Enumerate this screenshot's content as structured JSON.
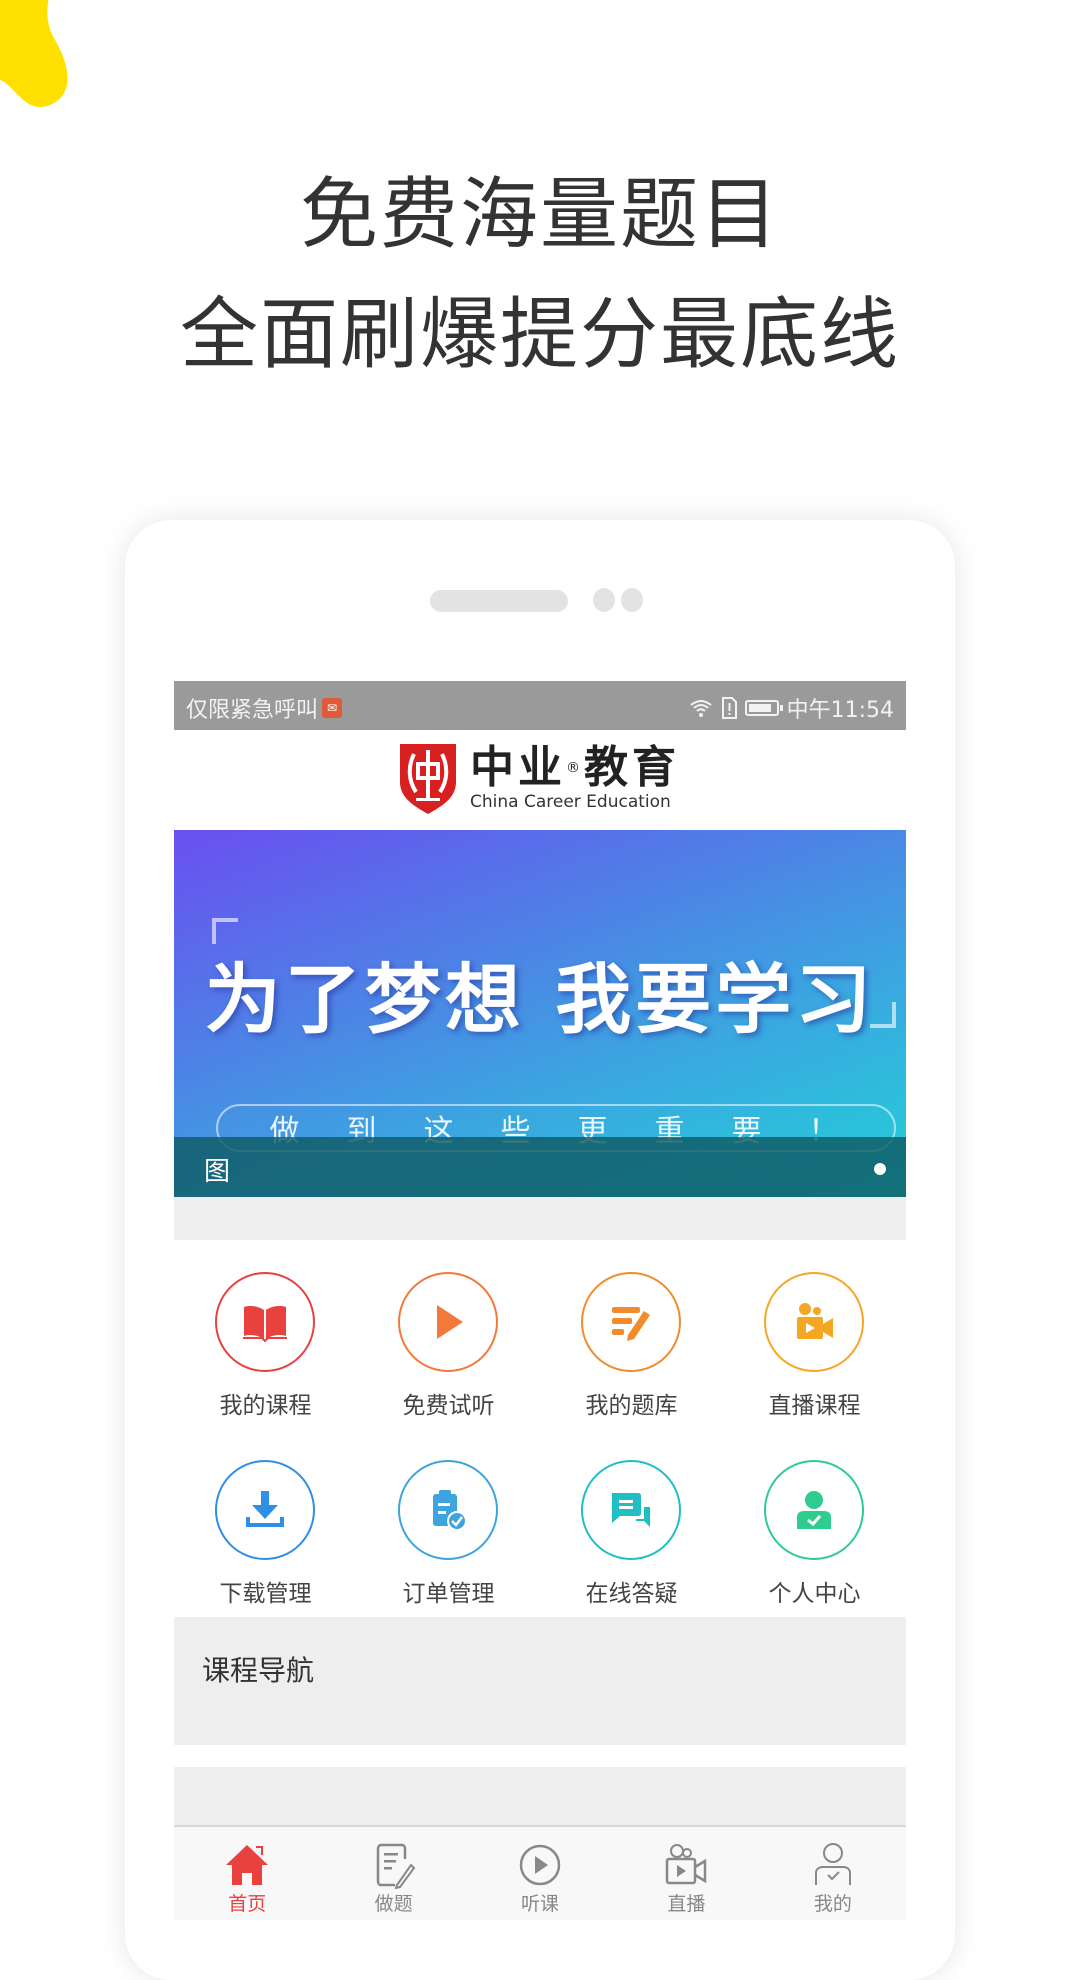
{
  "promo": {
    "headline_1": "免费海量题目",
    "headline_2": "全面刷爆提分最底线",
    "accent_yellow": "#ffe000"
  },
  "status_bar": {
    "left_text": "仅限紧急呼叫",
    "left_badge_icon": "app-notification-icon",
    "time": "中午11:54",
    "icons": [
      "wifi-icon",
      "sim-alert-icon",
      "battery-icon"
    ]
  },
  "header": {
    "brand_cn": "中业",
    "brand_registered": "®",
    "brand_cn_2": "教育",
    "brand_en": "China Career Education",
    "brand_color": "#d7201f"
  },
  "banner": {
    "title": "为了梦想 我要学习",
    "subtitle_chars": [
      "做",
      "到",
      "这",
      "些",
      "更",
      "重",
      "要",
      "！"
    ],
    "caption": "图",
    "page_index": 1,
    "page_count": 1
  },
  "grid": {
    "items": [
      {
        "label": "我的课程",
        "icon": "book-icon",
        "color": "#e8413e"
      },
      {
        "label": "免费试听",
        "icon": "play-icon",
        "color": "#f2793a"
      },
      {
        "label": "我的题库",
        "icon": "edit-list-icon",
        "color": "#f28c2a"
      },
      {
        "label": "直播课程",
        "icon": "video-camera-icon",
        "color": "#f5a623"
      },
      {
        "label": "下载管理",
        "icon": "download-icon",
        "color": "#2f8fe6"
      },
      {
        "label": "订单管理",
        "icon": "clipboard-check-icon",
        "color": "#3ea4e0"
      },
      {
        "label": "在线答疑",
        "icon": "chat-icon",
        "color": "#1fbfc4"
      },
      {
        "label": "个人中心",
        "icon": "user-check-icon",
        "color": "#2ecc8e"
      }
    ]
  },
  "course_nav": {
    "title": "课程导航"
  },
  "tabbar": {
    "active_color": "#e8413e",
    "inactive_color": "#888888",
    "tabs": [
      {
        "label": "首页",
        "icon": "home-icon",
        "active": true
      },
      {
        "label": "做题",
        "icon": "notepad-pen-icon",
        "active": false
      },
      {
        "label": "听课",
        "icon": "play-circle-icon",
        "active": false
      },
      {
        "label": "直播",
        "icon": "video-camera-icon",
        "active": false
      },
      {
        "label": "我的",
        "icon": "user-icon",
        "active": false
      }
    ]
  }
}
